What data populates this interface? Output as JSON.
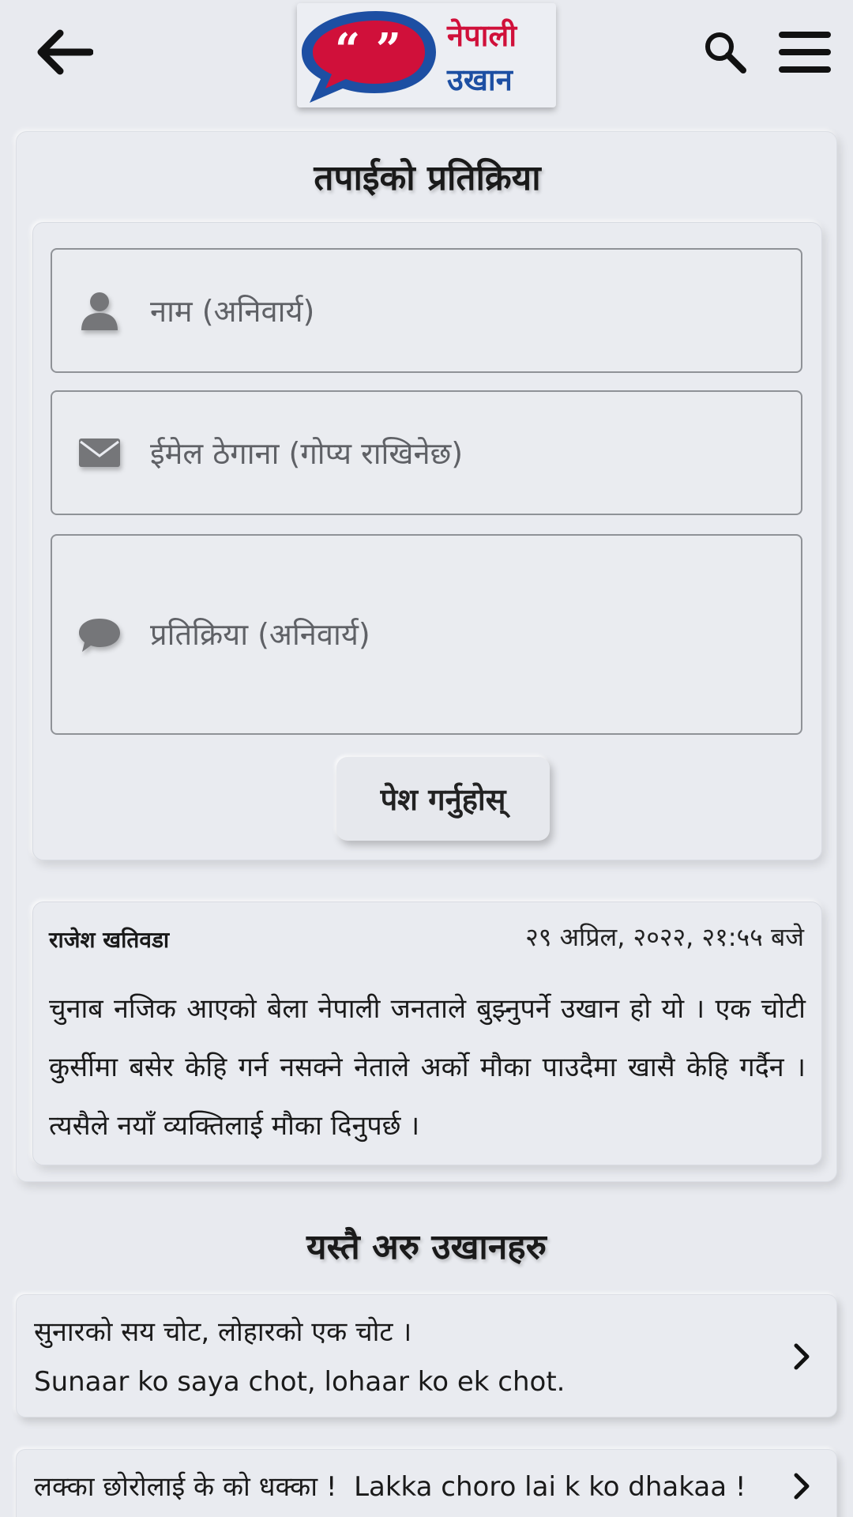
{
  "header": {
    "back_icon": "arrow-left-icon",
    "logo": {
      "line1": "नेपाली",
      "line2": "उखान",
      "quote_mark": "“ ”",
      "brand_red": "#d0103a",
      "brand_blue": "#1d4fa3"
    },
    "search_icon": "search-icon",
    "menu_icon": "hamburger-menu-icon"
  },
  "feedback": {
    "title": "तपाईको प्रतिक्रिया",
    "name_placeholder": "नाम (अनिवार्य)",
    "email_placeholder": "ईमेल ठेगाना (गोप्य राखिनेछ)",
    "comment_placeholder": "प्रतिक्रिया (अनिवार्य)",
    "submit_label": "पेश गर्नुहोस्"
  },
  "comment": {
    "author": "राजेश खतिवडा",
    "date": "२९ अप्रिल, २०२२, २१:५५ बजे",
    "text": "चुनाब नजिक आएको बेला नेपाली जनताले बुझ्नुपर्ने उखान हो यो । एक चोटी कुर्सीमा बसेर केहि गर्न नसक्ने नेताले अर्को मौका पाउदैमा खासै केहि गर्दैन । त्यसैले नयाँ व्यक्तिलाई मौका दिनुपर्छ ।"
  },
  "related": {
    "title": "यस्तै अरु उखानहरु",
    "items": [
      {
        "nepali": "सुनारको सय चोट, लोहारको एक चोट ।",
        "roman": "Sunaar ko saya chot, lohaar ko ek chot."
      },
      {
        "nepali": "लक्का छोरोलाई के को धक्का !",
        "roman": "Lakka choro lai k ko dhakaa !"
      }
    ]
  }
}
